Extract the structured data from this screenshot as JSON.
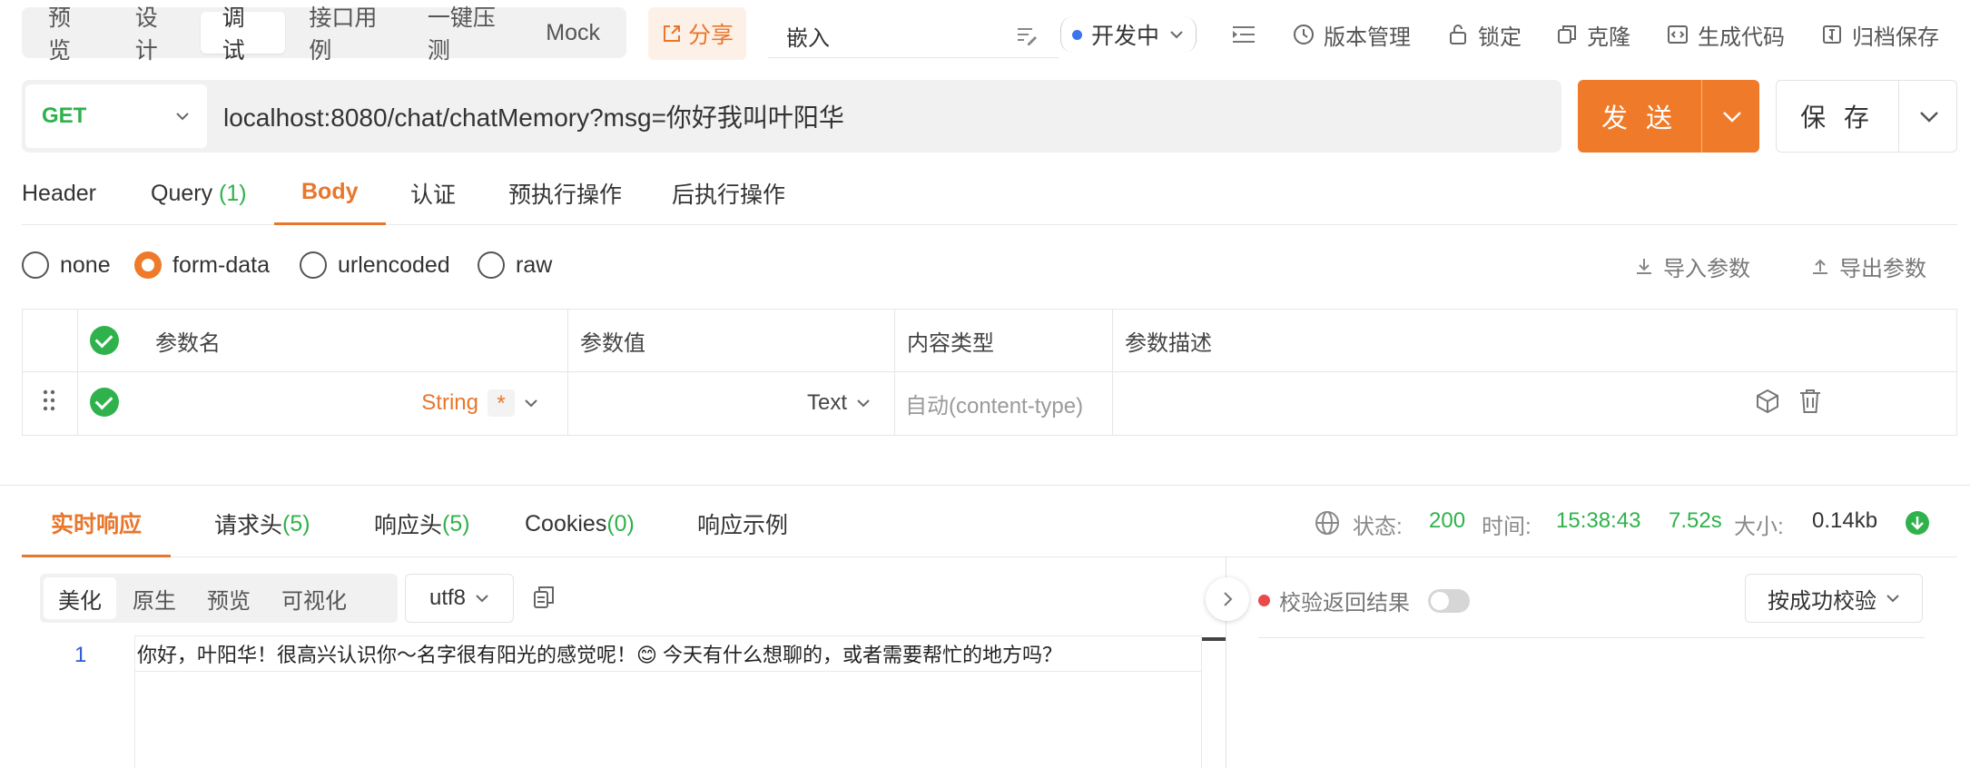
{
  "mode_tabs": [
    "预 览",
    "设 计",
    "调 试",
    "接口用例",
    "一键压测",
    "Mock"
  ],
  "share_label": "分享",
  "embed_label": "嵌入",
  "env_label": "开发中",
  "actions": {
    "version": "版本管理",
    "lock": "锁定",
    "clone": "克隆",
    "gencode": "生成代码",
    "archive": "归档保存"
  },
  "request": {
    "method": "GET",
    "url": "localhost:8080/chat/chatMemory?msg=你好我叫叶阳华"
  },
  "send_label": "发 送",
  "save_label": "保 存",
  "req_tabs": {
    "header": "Header",
    "query": "Query",
    "query_count": "(1)",
    "body": "Body",
    "auth": "认证",
    "pre": "预执行操作",
    "post": "后执行操作"
  },
  "body_types": {
    "none": "none",
    "form_data": "form-data",
    "urlencoded": "urlencoded",
    "raw": "raw",
    "selected": "form-data"
  },
  "param_actions": {
    "import": "导入参数",
    "export": "导出参数"
  },
  "table": {
    "headers": {
      "name": "参数名",
      "value": "参数值",
      "ctype": "内容类型",
      "desc": "参数描述"
    },
    "row": {
      "type": "String",
      "required": "*",
      "value_type": "Text",
      "content_type_placeholder": "自动(content-type)"
    }
  },
  "resp_tabs": {
    "live": "实时响应",
    "req_headers": "请求头",
    "req_headers_count": "(5)",
    "resp_headers": "响应头",
    "resp_headers_count": "(5)",
    "cookies": "Cookies",
    "cookies_count": "(0)",
    "example": "响应示例"
  },
  "status": {
    "status_label": "状态:",
    "status_code": "200",
    "time_label": "时间:",
    "time": "15:38:43",
    "duration": "7.52s",
    "size_label": "大小:",
    "size": "0.14kb"
  },
  "format_tabs": [
    "美化",
    "原生",
    "预览",
    "可视化"
  ],
  "encoding": "utf8",
  "editor": {
    "line": "1",
    "text": "你好，叶阳华！很高兴认识你～名字很有阳光的感觉呢！😊 今天有什么想聊的，或者需要帮忙的地方吗？"
  },
  "validate": {
    "label": "校验返回结果",
    "success_sel": "按成功校验"
  },
  "colors": {
    "accent": "#ee7a2a",
    "success": "#2fb24c",
    "method": "#2fb24c",
    "env_dot": "#3b73f0"
  }
}
